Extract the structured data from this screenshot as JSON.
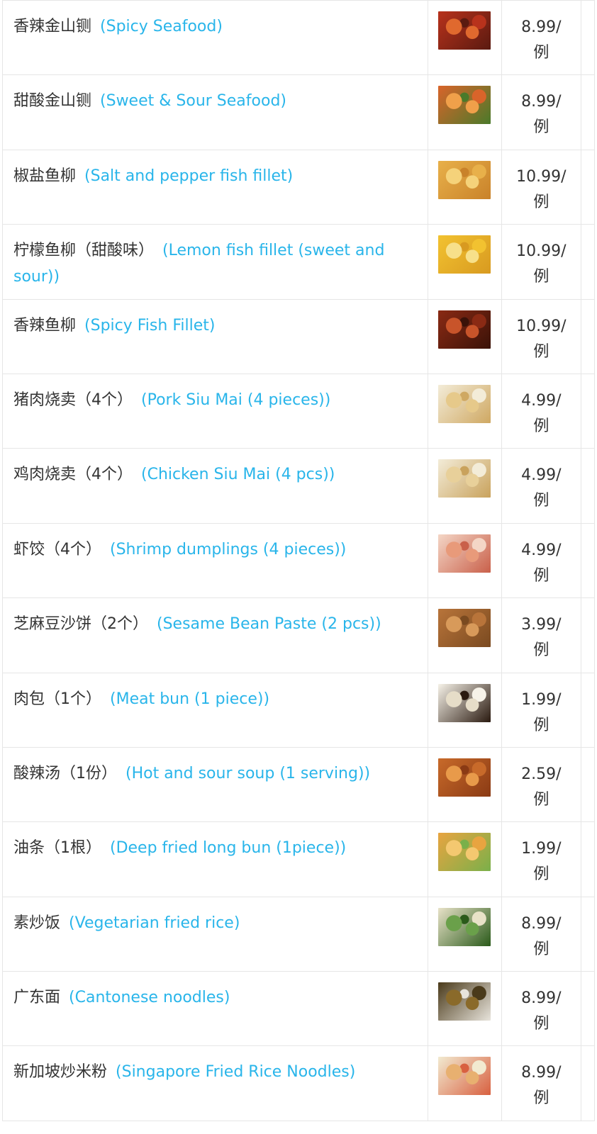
{
  "menu": {
    "items": [
      {
        "zh": "香辣金山铡",
        "en": "(Spicy Seafood)",
        "price": "8.99/",
        "unit": "例",
        "image": "spicy-seafood-photo",
        "colors": [
          "#b8321c",
          "#e0692e",
          "#5a1a10"
        ]
      },
      {
        "zh": "甜酸金山铡",
        "en": "(Sweet & Sour Seafood)",
        "price": "8.99/",
        "unit": "例",
        "image": "sweet-sour-seafood-photo",
        "colors": [
          "#d9642a",
          "#f0a04a",
          "#4a7a2a"
        ]
      },
      {
        "zh": "椒盐鱼柳",
        "en": "(Salt and pepper fish fillet)",
        "price": "10.99/",
        "unit": "例",
        "image": "salt-pepper-fish-photo",
        "colors": [
          "#e8b04a",
          "#f5d27a",
          "#c9822a"
        ]
      },
      {
        "zh": "柠檬鱼柳（甜酸味）",
        "en": "(Lemon fish fillet (sweet and sour))",
        "price": "10.99/",
        "unit": "例",
        "image": "lemon-fish-photo",
        "colors": [
          "#f2c230",
          "#f7e08a",
          "#d89a20"
        ]
      },
      {
        "zh": "香辣鱼柳",
        "en": "(Spicy Fish Fillet)",
        "price": "10.99/",
        "unit": "例",
        "image": "spicy-fish-photo",
        "colors": [
          "#8a2a14",
          "#c8542a",
          "#3a1208"
        ]
      },
      {
        "zh": "猪肉烧卖（4个）",
        "en": "(Pork Siu Mai (4 pieces))",
        "price": "4.99/",
        "unit": "例",
        "image": "pork-siu-mai-photo",
        "colors": [
          "#f3ecd8",
          "#e6c98a",
          "#cfa862"
        ]
      },
      {
        "zh": "鸡肉烧卖（4个）",
        "en": "(Chicken Siu Mai (4 pcs))",
        "price": "4.99/",
        "unit": "例",
        "image": "chicken-siu-mai-photo",
        "colors": [
          "#f3ecd8",
          "#e8d09a",
          "#c9a25c"
        ]
      },
      {
        "zh": "虾饺（4个）",
        "en": "(Shrimp dumplings (4 pieces))",
        "price": "4.99/",
        "unit": "例",
        "image": "shrimp-dumplings-photo",
        "colors": [
          "#f4d6c6",
          "#e89a7a",
          "#c9604a"
        ]
      },
      {
        "zh": "芝麻豆沙饼（2个）",
        "en": "(Sesame Bean Paste (2 pcs))",
        "price": "3.99/",
        "unit": "例",
        "image": "sesame-bean-paste-photo",
        "colors": [
          "#b8743a",
          "#d89a5a",
          "#7a4a20"
        ]
      },
      {
        "zh": "肉包（1个）",
        "en": "(Meat bun (1 piece))",
        "price": "1.99/",
        "unit": "例",
        "image": "meat-bun-photo",
        "colors": [
          "#f6f2e8",
          "#e6ddc8",
          "#2a1a10"
        ]
      },
      {
        "zh": "酸辣汤（1份）",
        "en": "(Hot and sour soup (1 serving))",
        "price": "2.59/",
        "unit": "例",
        "image": "hot-sour-soup-photo",
        "colors": [
          "#c86a2a",
          "#e89a4a",
          "#8a3a14"
        ]
      },
      {
        "zh": "油条（1根）",
        "en": "(Deep fried long bun (1piece))",
        "price": "1.99/",
        "unit": "例",
        "image": "fried-bun-photo",
        "colors": [
          "#e8a440",
          "#f4c870",
          "#7ab04a"
        ]
      },
      {
        "zh": "素炒饭",
        "en": "(Vegetarian fried rice)",
        "price": "8.99/",
        "unit": "例",
        "image": "vegetarian-fried-rice-photo",
        "colors": [
          "#e8e2c8",
          "#6aa04a",
          "#2a5a1a"
        ]
      },
      {
        "zh": "广东面",
        "en": "(Cantonese noodles)",
        "price": "8.99/",
        "unit": "例",
        "image": "cantonese-noodles-photo",
        "colors": [
          "#4a3a1a",
          "#8a6a2a",
          "#e8e4dc"
        ]
      },
      {
        "zh": "新加坡炒米粉",
        "en": "(Singapore Fried Rice Noodles)",
        "price": "8.99/",
        "unit": "例",
        "image": "singapore-noodles-photo",
        "colors": [
          "#f2ead0",
          "#e8b070",
          "#d86040"
        ]
      }
    ]
  }
}
